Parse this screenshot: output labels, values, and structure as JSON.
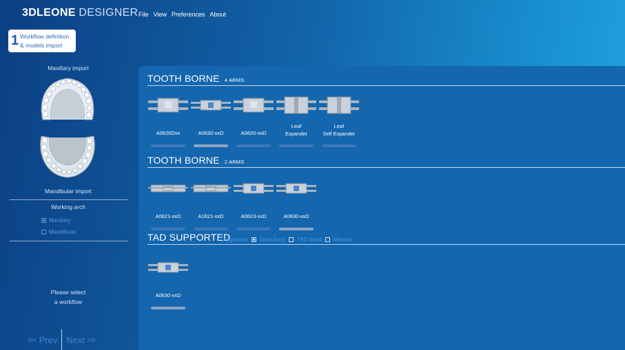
{
  "app": {
    "brand_bold": "3DLEONE",
    "brand_light": "DESIGNER",
    "menu": [
      "File",
      "View",
      "Preferences",
      "About"
    ]
  },
  "step": {
    "number": "1",
    "line1": "Workflow definition",
    "line2": "& models import"
  },
  "left": {
    "maxillary_label": "Maxillary import",
    "mandibular_label": "Mandibular import",
    "working_arch_label": "Working arch",
    "arch_options": [
      {
        "label": "Maxillary",
        "checked": true
      },
      {
        "label": "Mandibular",
        "checked": false
      }
    ],
    "prompt_line1": "Please select",
    "prompt_line2": "a workflow",
    "prev_label": "Prev",
    "next_label": "Next"
  },
  "sections": {
    "tooth4": {
      "title": "TOOTH BORNE",
      "subtitle": "4 ARMS",
      "items": [
        {
          "name": "A0620Dxx",
          "progress": 0.0
        },
        {
          "name": "A0630-xxD",
          "progress": 1.0
        },
        {
          "name": "A0620-xxD",
          "progress": 0.0
        },
        {
          "name": "Leaf\nExpander",
          "progress": 0.0
        },
        {
          "name": "Leaf\nSelf Expander",
          "progress": 0.0
        }
      ]
    },
    "tooth2": {
      "title": "TOOTH BORNE",
      "subtitle": "2 ARMS",
      "items": [
        {
          "name": "A0621-xxD",
          "progress": 0.0
        },
        {
          "name": "A1621-xxD",
          "progress": 0.0
        },
        {
          "name": "A0623-xxD",
          "progress": 0.0
        },
        {
          "name": "A0630-xxD",
          "progress": 1.0
        }
      ]
    },
    "tad": {
      "title": "TAD SUPPORTED",
      "options": [
        {
          "label": "Alignment",
          "checked": false,
          "has_box": false
        },
        {
          "label": "Scan body",
          "checked": true,
          "has_box": true
        },
        {
          "label": "TAD head",
          "checked": false,
          "has_box": true
        },
        {
          "label": "Manual",
          "checked": false,
          "has_box": true
        }
      ],
      "items": [
        {
          "name": "A0630-xxD",
          "progress": 1.0
        }
      ]
    }
  },
  "colors": {
    "panel": "#1466ae",
    "step_text": "#1a5ea8",
    "option_blue": "#3f9ae4"
  }
}
